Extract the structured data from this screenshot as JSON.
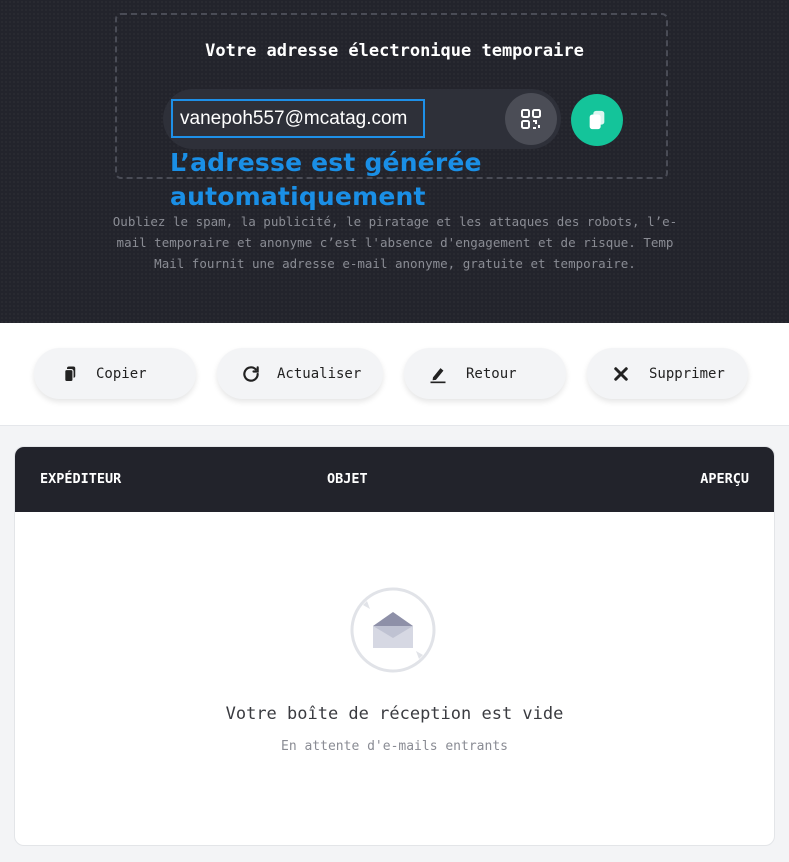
{
  "hero": {
    "title": "Votre adresse électronique temporaire",
    "email": "vanepoh557@mcatag.com",
    "auto_label": "L’adresse est générée automatiquement",
    "description": "Oubliez le spam, la publicité, le piratage et les attaques des robots, l’e-mail temporaire et anonyme c’est l'absence d'engagement et de risque. Temp Mail fournit une adresse e-mail anonyme, gratuite et temporaire."
  },
  "actions": [
    {
      "label": "Copier",
      "icon": "copy-icon"
    },
    {
      "label": "Actualiser",
      "icon": "refresh-icon"
    },
    {
      "label": "Retour",
      "icon": "edit-icon"
    },
    {
      "label": "Supprimer",
      "icon": "close-icon"
    }
  ],
  "inbox": {
    "columns": [
      "EXPÉDITEUR",
      "OBJET",
      "APERÇU"
    ],
    "empty_title": "Votre boîte de réception est vide",
    "empty_subtitle": "En attente d'e-mails entrants"
  },
  "colors": {
    "hero_bg": "#23242c",
    "accent_green": "#14c49a",
    "accent_blue": "#1a8fe6",
    "table_header_bg": "#22232b"
  }
}
